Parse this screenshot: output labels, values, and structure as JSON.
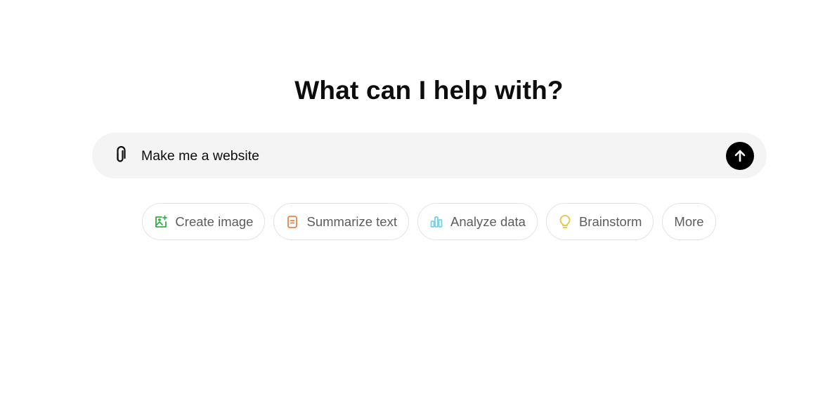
{
  "headline": "What can I help with?",
  "composer": {
    "value": "Make me a website",
    "attach_icon": "paperclip-icon",
    "send_icon": "arrow-up-icon"
  },
  "chips": [
    {
      "label": "Create image",
      "icon": "image-sparkle-icon",
      "color": "#35ae47"
    },
    {
      "label": "Summarize text",
      "icon": "document-icon",
      "color": "#ea8444"
    },
    {
      "label": "Analyze data",
      "icon": "bar-chart-icon",
      "color": "#76d0eb"
    },
    {
      "label": "Brainstorm",
      "icon": "lightbulb-icon",
      "color": "#e2c541"
    },
    {
      "label": "More"
    }
  ]
}
